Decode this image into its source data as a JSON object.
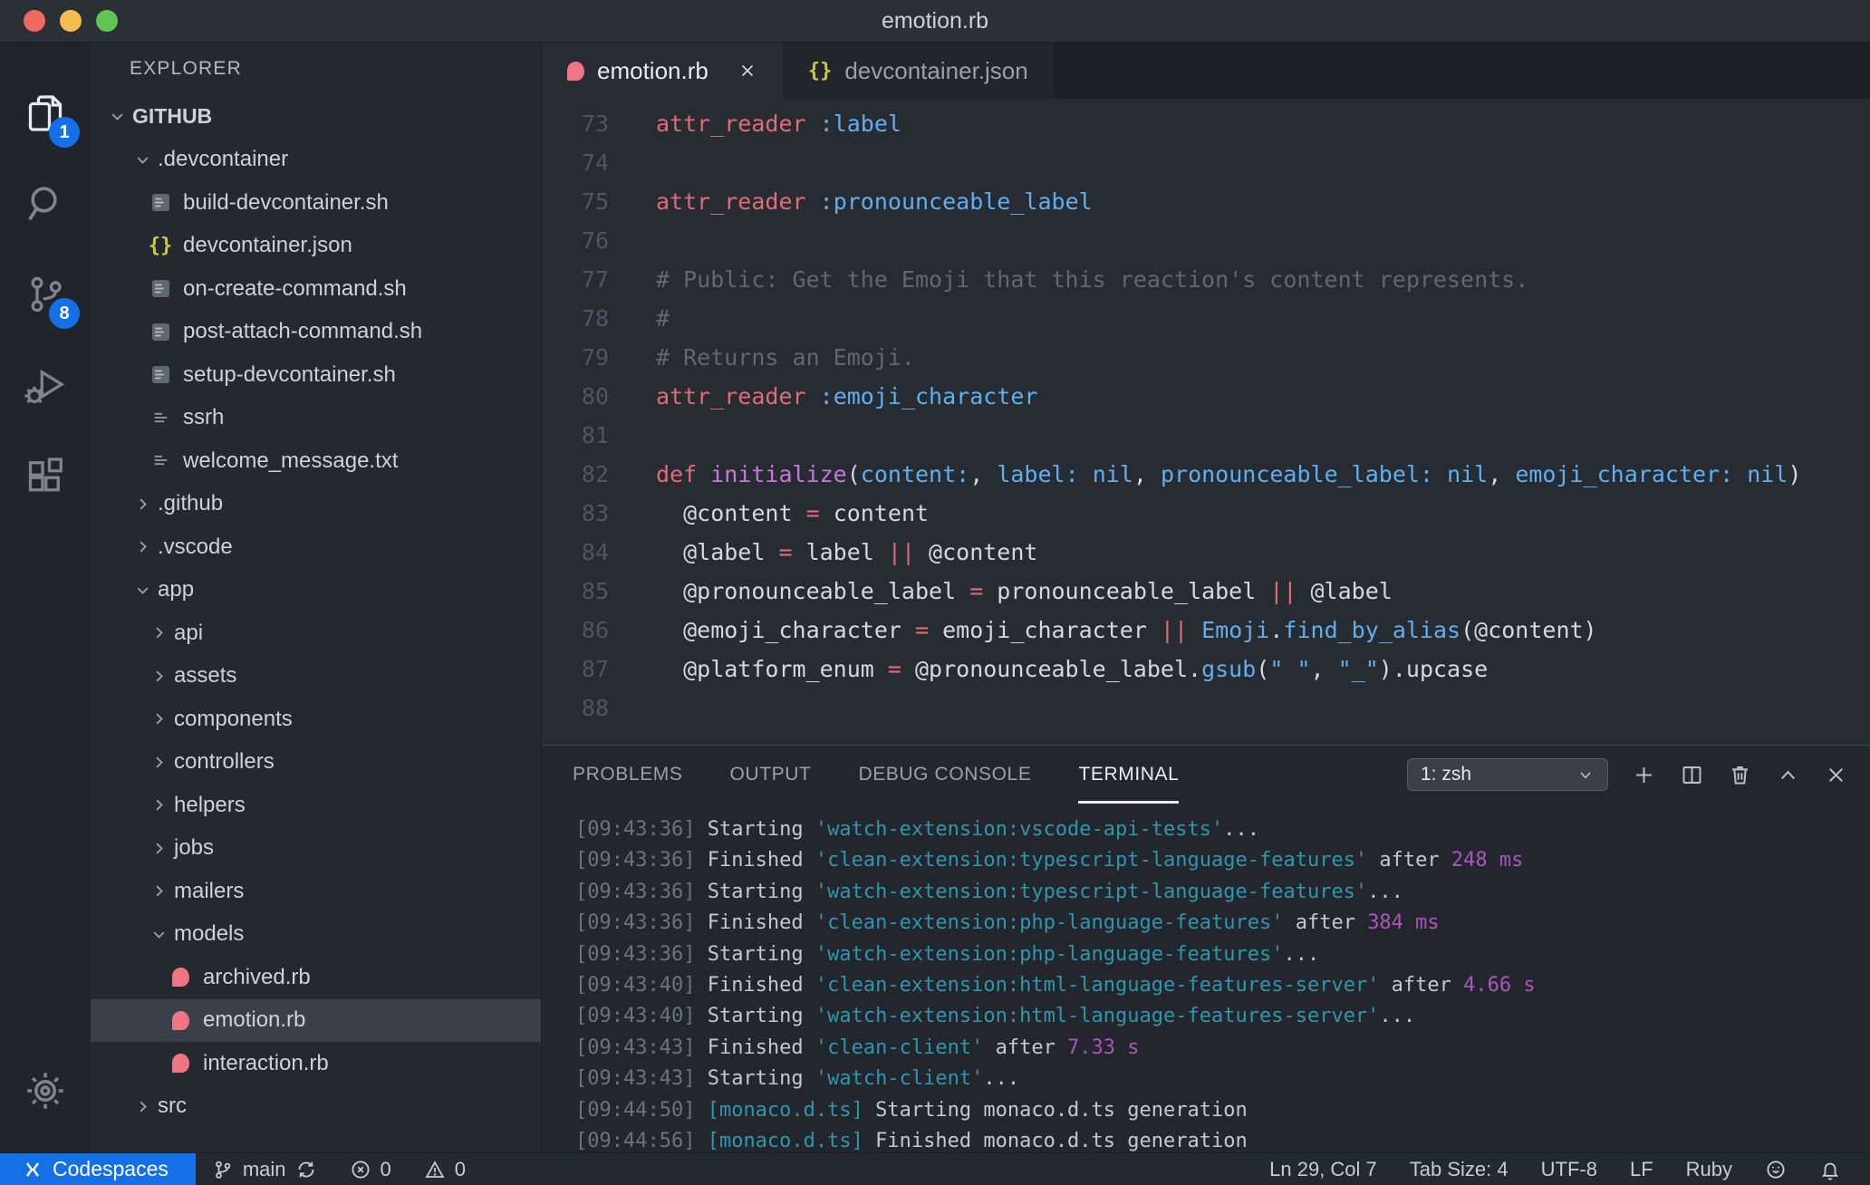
{
  "colors": {
    "accent_blue": "#1570e8",
    "ruby_pink": "#ef7585",
    "json_yellow": "#cbcb41",
    "keyword_red": "#e06c75",
    "symbol_blue": "#61afef",
    "func_purple": "#c678dd",
    "terminal_cyan": "#2f97ad",
    "terminal_magenta": "#aa55be"
  },
  "glyphs": {
    "json_braces": "{}"
  },
  "window": {
    "title": "emotion.rb"
  },
  "activity_bar": {
    "items": [
      {
        "name": "explorer",
        "icon": "files-icon",
        "badge": "1",
        "active": true
      },
      {
        "name": "search",
        "icon": "search-icon"
      },
      {
        "name": "source-control",
        "icon": "source-control-icon",
        "badge": "8"
      },
      {
        "name": "run-debug",
        "icon": "debug-icon"
      },
      {
        "name": "extensions",
        "icon": "extensions-icon"
      }
    ],
    "bottom": [
      {
        "name": "settings",
        "icon": "gear-icon"
      }
    ]
  },
  "sidebar": {
    "header": "EXPLORER",
    "tree": [
      {
        "label": "GITHUB",
        "type": "root",
        "expanded": true,
        "level": 0
      },
      {
        "label": ".devcontainer",
        "type": "folder",
        "expanded": true,
        "level": 1
      },
      {
        "label": "build-devcontainer.sh",
        "type": "shell",
        "level": 2
      },
      {
        "label": "devcontainer.json",
        "type": "json",
        "level": 2
      },
      {
        "label": "on-create-command.sh",
        "type": "shell",
        "level": 2
      },
      {
        "label": "post-attach-command.sh",
        "type": "shell",
        "level": 2
      },
      {
        "label": "setup-devcontainer.sh",
        "type": "shell",
        "level": 2
      },
      {
        "label": "ssrh",
        "type": "text",
        "level": 2
      },
      {
        "label": "welcome_message.txt",
        "type": "text",
        "level": 2
      },
      {
        "label": ".github",
        "type": "folder",
        "expanded": false,
        "level": 1
      },
      {
        "label": ".vscode",
        "type": "folder",
        "expanded": false,
        "level": 1
      },
      {
        "label": "app",
        "type": "folder",
        "expanded": true,
        "level": 1
      },
      {
        "label": "api",
        "type": "folder",
        "expanded": false,
        "level": 2
      },
      {
        "label": "assets",
        "type": "folder",
        "expanded": false,
        "level": 2
      },
      {
        "label": "components",
        "type": "folder",
        "expanded": false,
        "level": 2
      },
      {
        "label": "controllers",
        "type": "folder",
        "expanded": false,
        "level": 2
      },
      {
        "label": "helpers",
        "type": "folder",
        "expanded": false,
        "level": 2
      },
      {
        "label": "jobs",
        "type": "folder",
        "expanded": false,
        "level": 2
      },
      {
        "label": "mailers",
        "type": "folder",
        "expanded": false,
        "level": 2
      },
      {
        "label": "models",
        "type": "folder",
        "expanded": true,
        "level": 2
      },
      {
        "label": "archived.rb",
        "type": "ruby",
        "level": 3
      },
      {
        "label": "emotion.rb",
        "type": "ruby",
        "level": 3,
        "selected": true
      },
      {
        "label": "interaction.rb",
        "type": "ruby",
        "level": 3
      },
      {
        "label": "src",
        "type": "folder",
        "expanded": false,
        "level": 1
      }
    ]
  },
  "editor": {
    "tabs": [
      {
        "label": "emotion.rb",
        "icon": "ruby-file-icon",
        "active": true,
        "closable": true
      },
      {
        "label": "devcontainer.json",
        "icon": "json-file-icon",
        "active": false
      }
    ],
    "code": [
      {
        "n": "73",
        "segs": [
          [
            "attr_reader",
            "red"
          ],
          [
            " ",
            "fg"
          ],
          [
            ":label",
            "blue"
          ]
        ]
      },
      {
        "n": "74",
        "segs": []
      },
      {
        "n": "75",
        "segs": [
          [
            "attr_reader",
            "red"
          ],
          [
            " ",
            "fg"
          ],
          [
            ":pronounceable_label",
            "blue"
          ]
        ]
      },
      {
        "n": "76",
        "segs": []
      },
      {
        "n": "77",
        "segs": [
          [
            "# Public: Get the Emoji that this reaction's content represents.",
            "comment"
          ]
        ]
      },
      {
        "n": "78",
        "segs": [
          [
            "#",
            "comment"
          ]
        ]
      },
      {
        "n": "79",
        "segs": [
          [
            "# Returns an Emoji.",
            "comment"
          ]
        ]
      },
      {
        "n": "80",
        "segs": [
          [
            "attr_reader",
            "red"
          ],
          [
            " ",
            "fg"
          ],
          [
            ":emoji_character",
            "blue"
          ]
        ]
      },
      {
        "n": "81",
        "segs": []
      },
      {
        "n": "82",
        "segs": [
          [
            "def",
            "red"
          ],
          [
            " ",
            "fg"
          ],
          [
            "initialize",
            "purple"
          ],
          [
            "(",
            "fg"
          ],
          [
            "content:",
            "blue"
          ],
          [
            ", ",
            "fg"
          ],
          [
            "label:",
            "blue"
          ],
          [
            " ",
            "fg"
          ],
          [
            "nil",
            "blue"
          ],
          [
            ", ",
            "fg"
          ],
          [
            "pronounceable_label:",
            "blue"
          ],
          [
            " ",
            "fg"
          ],
          [
            "nil",
            "blue"
          ],
          [
            ", ",
            "fg"
          ],
          [
            "emoji_character:",
            "blue"
          ],
          [
            " ",
            "fg"
          ],
          [
            "nil",
            "blue"
          ],
          [
            ")",
            "fg"
          ]
        ]
      },
      {
        "n": "83",
        "segs": [
          [
            "  @content ",
            "fg"
          ],
          [
            "=",
            "red"
          ],
          [
            " content",
            "fg"
          ]
        ]
      },
      {
        "n": "84",
        "segs": [
          [
            "  @label ",
            "fg"
          ],
          [
            "=",
            "red"
          ],
          [
            " label ",
            "fg"
          ],
          [
            "||",
            "red"
          ],
          [
            " @content",
            "fg"
          ]
        ]
      },
      {
        "n": "85",
        "segs": [
          [
            "  @pronounceable_label ",
            "fg"
          ],
          [
            "=",
            "red"
          ],
          [
            " pronounceable_label ",
            "fg"
          ],
          [
            "||",
            "red"
          ],
          [
            " @label",
            "fg"
          ]
        ]
      },
      {
        "n": "86",
        "segs": [
          [
            "  @emoji_character ",
            "fg"
          ],
          [
            "=",
            "red"
          ],
          [
            " emoji_character ",
            "fg"
          ],
          [
            "||",
            "red"
          ],
          [
            " ",
            "fg"
          ],
          [
            "Emoji",
            "blue"
          ],
          [
            ".",
            "fg"
          ],
          [
            "find_by_alias",
            "blue"
          ],
          [
            "(@content)",
            "fg"
          ]
        ]
      },
      {
        "n": "87",
        "segs": [
          [
            "  @platform_enum ",
            "fg"
          ],
          [
            "=",
            "red"
          ],
          [
            " @pronounceable_label.",
            "fg"
          ],
          [
            "gsub",
            "blue"
          ],
          [
            "(",
            "fg"
          ],
          [
            "\" \"",
            "blue"
          ],
          [
            ", ",
            "fg"
          ],
          [
            "\"_\"",
            "blue"
          ],
          [
            ")",
            "fg"
          ],
          [
            ".upcase",
            "fg"
          ]
        ]
      },
      {
        "n": "88",
        "segs": []
      }
    ]
  },
  "panel": {
    "tabs": [
      {
        "label": "PROBLEMS"
      },
      {
        "label": "OUTPUT"
      },
      {
        "label": "DEBUG CONSOLE"
      },
      {
        "label": "TERMINAL",
        "active": true
      }
    ],
    "terminal_select": {
      "value": "1: zsh"
    },
    "actions": [
      {
        "name": "new-terminal",
        "icon": "plus-icon"
      },
      {
        "name": "split-terminal",
        "icon": "split-icon"
      },
      {
        "name": "kill-terminal",
        "icon": "trash-icon"
      },
      {
        "name": "maximize-panel",
        "icon": "chevron-up-icon"
      },
      {
        "name": "close-panel",
        "icon": "close-icon"
      }
    ],
    "lines": [
      {
        "segs": [
          [
            "[09:43:36]",
            "time"
          ],
          [
            " Starting ",
            "tfg"
          ],
          [
            "'watch-extension:vscode-api-tests'",
            "cyan"
          ],
          [
            "...",
            "tfg"
          ]
        ]
      },
      {
        "segs": [
          [
            "[09:43:36]",
            "time"
          ],
          [
            " Finished ",
            "tfg"
          ],
          [
            "'clean-extension:typescript-language-features'",
            "cyan"
          ],
          [
            " after ",
            "tfg"
          ],
          [
            "248 ms",
            "mag"
          ]
        ]
      },
      {
        "segs": [
          [
            "[09:43:36]",
            "time"
          ],
          [
            " Starting ",
            "tfg"
          ],
          [
            "'watch-extension:typescript-language-features'",
            "cyan"
          ],
          [
            "...",
            "tfg"
          ]
        ]
      },
      {
        "segs": [
          [
            "[09:43:36]",
            "time"
          ],
          [
            " Finished ",
            "tfg"
          ],
          [
            "'clean-extension:php-language-features'",
            "cyan"
          ],
          [
            " after ",
            "tfg"
          ],
          [
            "384 ms",
            "mag"
          ]
        ]
      },
      {
        "segs": [
          [
            "[09:43:36]",
            "time"
          ],
          [
            " Starting ",
            "tfg"
          ],
          [
            "'watch-extension:php-language-features'",
            "cyan"
          ],
          [
            "...",
            "tfg"
          ]
        ]
      },
      {
        "segs": [
          [
            "[09:43:40]",
            "time"
          ],
          [
            " Finished ",
            "tfg"
          ],
          [
            "'clean-extension:html-language-features-server'",
            "cyan"
          ],
          [
            " after ",
            "tfg"
          ],
          [
            "4.66 s",
            "mag"
          ]
        ]
      },
      {
        "segs": [
          [
            "[09:43:40]",
            "time"
          ],
          [
            " Starting ",
            "tfg"
          ],
          [
            "'watch-extension:html-language-features-server'",
            "cyan"
          ],
          [
            "...",
            "tfg"
          ]
        ]
      },
      {
        "segs": [
          [
            "[09:43:43]",
            "time"
          ],
          [
            " Finished ",
            "tfg"
          ],
          [
            "'clean-client'",
            "cyan"
          ],
          [
            " after ",
            "tfg"
          ],
          [
            "7.33 s",
            "mag"
          ]
        ]
      },
      {
        "segs": [
          [
            "[09:43:43]",
            "time"
          ],
          [
            " Starting ",
            "tfg"
          ],
          [
            "'watch-client'",
            "cyan"
          ],
          [
            "...",
            "tfg"
          ]
        ]
      },
      {
        "segs": [
          [
            "[09:44:50]",
            "time"
          ],
          [
            " ",
            "tfg"
          ],
          [
            "[monaco.d.ts]",
            "cyan"
          ],
          [
            " Starting monaco.d.ts generation",
            "tfg"
          ]
        ]
      },
      {
        "segs": [
          [
            "[09:44:56]",
            "time"
          ],
          [
            " ",
            "tfg"
          ],
          [
            "[monaco.d.ts]",
            "cyan"
          ],
          [
            " Finished monaco.d.ts generation",
            "tfg"
          ]
        ]
      }
    ]
  },
  "status_bar": {
    "left": [
      {
        "name": "codespaces",
        "icon": "codespaces-icon",
        "label": "Codespaces",
        "accent": true
      },
      {
        "name": "branch",
        "icon": "branch-icon",
        "label": "main",
        "icon2": "sync-icon"
      },
      {
        "name": "error-count",
        "icon": "error-icon",
        "label": "0"
      },
      {
        "name": "warning-count",
        "icon": "warning-icon",
        "label": "0"
      }
    ],
    "right": [
      {
        "name": "cursor-position",
        "label": "Ln 29, Col 7"
      },
      {
        "name": "tab-size",
        "label": "Tab Size: 4"
      },
      {
        "name": "encoding",
        "label": "UTF-8"
      },
      {
        "name": "eol",
        "label": "LF"
      },
      {
        "name": "language-mode",
        "label": "Ruby"
      },
      {
        "name": "feedback",
        "icon": "smiley-icon"
      },
      {
        "name": "notifications",
        "icon": "bell-icon"
      }
    ]
  }
}
